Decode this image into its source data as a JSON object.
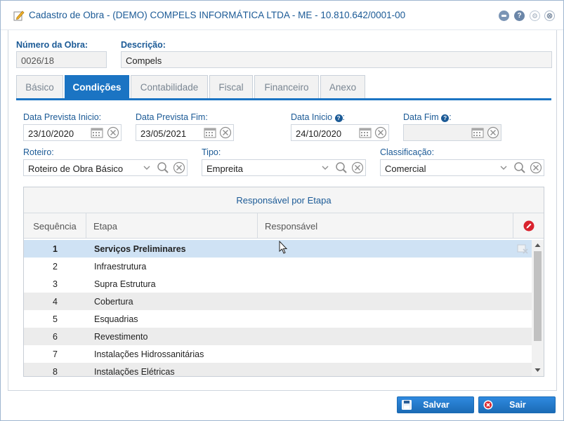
{
  "window": {
    "title": "Cadastro de Obra - (DEMO) COMPELS INFORMÁTICA LTDA - ME - 10.810.642/0001-00",
    "help_glyph": "?",
    "close_glyph": "⊗"
  },
  "header": {
    "numero_label": "Número da Obra:",
    "numero_value": "0026/18",
    "descricao_label": "Descrição:",
    "descricao_value": "Compels"
  },
  "tabs": [
    {
      "label": "Básico",
      "active": false
    },
    {
      "label": "Condições",
      "active": true
    },
    {
      "label": "Contabilidade",
      "active": false
    },
    {
      "label": "Fiscal",
      "active": false
    },
    {
      "label": "Financeiro",
      "active": false
    },
    {
      "label": "Anexo",
      "active": false
    }
  ],
  "dates": {
    "prevista_inicio_label": "Data Prevista Inicio:",
    "prevista_inicio_value": "23/10/2020",
    "prevista_fim_label": "Data Prevista Fim:",
    "prevista_fim_value": "23/05/2021",
    "inicio_label": "Data Inicio",
    "inicio_value": "24/10/2020",
    "fim_label": "Data Fim",
    "fim_value": "",
    "help_glyph": "?",
    "colon": ":"
  },
  "selects": {
    "roteiro_label": "Roteiro:",
    "roteiro_value": "Roteiro de Obra Básico",
    "tipo_label": "Tipo:",
    "tipo_value": "Empreita",
    "classificacao_label": "Classificação:",
    "classificacao_value": "Comercial"
  },
  "grid": {
    "title": "Responsável por Etapa",
    "columns": [
      "Sequência",
      "Etapa",
      "Responsável"
    ],
    "rows": [
      {
        "seq": "1",
        "etapa": "Serviços Preliminares",
        "selected": true
      },
      {
        "seq": "2",
        "etapa": "Infraestrutura",
        "selected": false
      },
      {
        "seq": "3",
        "etapa": "Supra Estrutura",
        "selected": false
      },
      {
        "seq": "4",
        "etapa": "Cobertura",
        "selected": false
      },
      {
        "seq": "5",
        "etapa": "Esquadrias",
        "selected": false
      },
      {
        "seq": "6",
        "etapa": "Revestimento",
        "selected": false
      },
      {
        "seq": "7",
        "etapa": "Instalações Hidrossanitárias",
        "selected": false
      },
      {
        "seq": "8",
        "etapa": "Instalações Elétricas",
        "selected": false
      }
    ],
    "scroll_position": 0.0
  },
  "footer": {
    "save_label": "Salvar",
    "exit_label": "Sair"
  },
  "colors": {
    "accent": "#1b74c3",
    "label": "#1b5a96",
    "selected_row": "#cfe2f4",
    "alt_row": "#ececec"
  }
}
